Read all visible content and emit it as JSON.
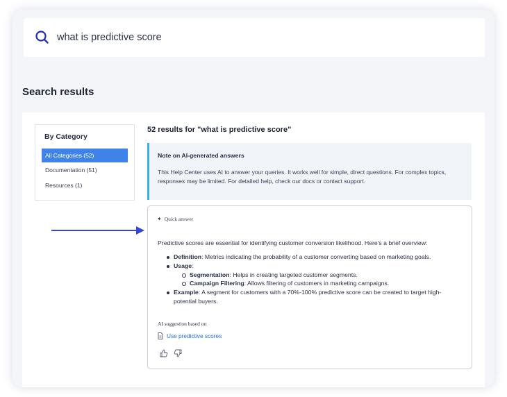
{
  "search": {
    "query": "what is predictive score",
    "icon": "search-icon"
  },
  "page_title": "Search results",
  "sidebar": {
    "title": "By Category",
    "items": [
      {
        "label": "All Categories (52)",
        "active": true
      },
      {
        "label": "Documentation (51)",
        "active": false
      },
      {
        "label": "Resources (1)",
        "active": false
      }
    ]
  },
  "results": {
    "count_text": "52 results for \"what is predictive score\""
  },
  "note": {
    "title": "Note on AI-generated answers",
    "body": "This Help Center uses AI to answer your queries. It works well for simple, direct questions. For complex topics, responses may be limited. For detailed help, check our docs or contact support."
  },
  "quick_answer": {
    "label": "Quick answer",
    "intro": "Predictive scores are essential for identifying customer conversion likelihood. Here's a brief overview:",
    "points": {
      "definition": {
        "term": "Definition",
        "text": ": Metrics indicating the probability of a customer converting based on marketing goals."
      },
      "usage": {
        "term": "Usage",
        "text": ":"
      },
      "segmentation": {
        "term": "Segmentation",
        "text": ": Helps in creating targeted customer segments."
      },
      "campaign": {
        "term": "Campaign Filtering",
        "text": ": Allows filtering of customers in marketing campaigns."
      },
      "example": {
        "term": "Example",
        "text": ": A segment for customers with a 70%-100% predictive score can be created to target high-",
        "text2": "potential buyers."
      }
    },
    "source_label": "AI suggestion based on",
    "source_link": "Use predictive scores"
  },
  "colors": {
    "accent": "#3f83e8",
    "note_border": "#3ab0e0",
    "link": "#1f6fd6",
    "arrow": "#3346d8"
  }
}
